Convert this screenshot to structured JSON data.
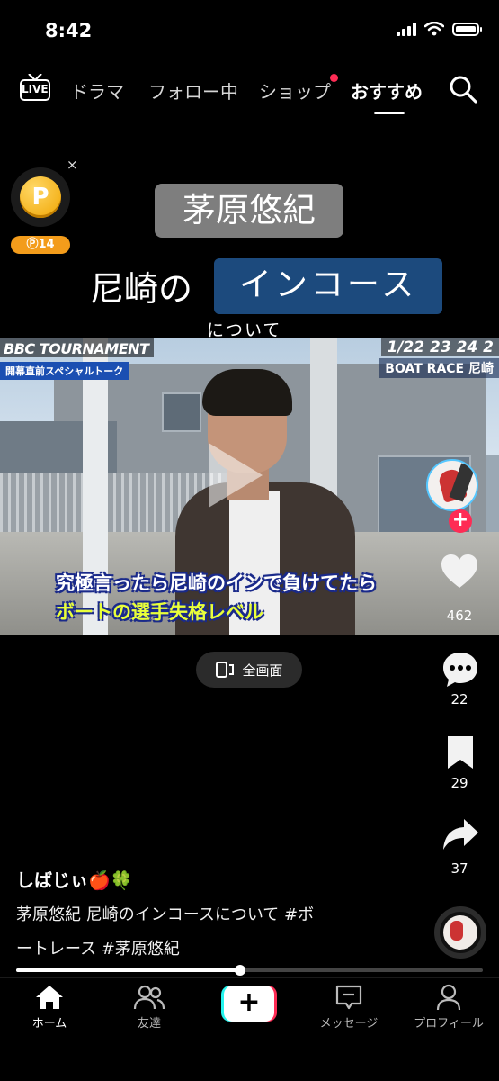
{
  "status_bar": {
    "time": "8:42"
  },
  "top_nav": {
    "live_label": "LIVE",
    "tabs": [
      "ドラマ",
      "フォロー中",
      "ショップ",
      "おすすめ"
    ],
    "active_tab": "おすすめ"
  },
  "coin_widget": {
    "close": "×",
    "symbol": "P",
    "count": "14",
    "count_prefix": "Ⓟ"
  },
  "overlay": {
    "title": "茅原悠紀",
    "line2_prefix": "尼崎の",
    "line2_highlight": "インコース",
    "line3": "について"
  },
  "video": {
    "broadcast_title": "BBC TOURNAMENT",
    "subtitle_badge": "開幕直前スペシャルトーク",
    "dates": "1/22 23 24 2",
    "venue": "BOAT RACE 尼崎",
    "caption_line1": "究極言ったら尼崎のインで負けてたら",
    "caption_line2": "ボートの選手失格レベル"
  },
  "fullscreen": {
    "label": "全画面"
  },
  "actions": {
    "likes": "462",
    "comments": "22",
    "bookmarks": "29",
    "shares": "37"
  },
  "post": {
    "username": "しばじぃ🍎🍀",
    "caption_line1": "茅原悠紀 尼崎のインコースについて #ボ",
    "caption_line2": "ートレース #茅原悠紀"
  },
  "progress": {
    "fraction": 0.48
  },
  "bottom_nav": {
    "home": "ホーム",
    "friends": "友達",
    "create": "+",
    "messages": "メッセージ",
    "profile": "プロフィール"
  },
  "colors": {
    "accent_red": "#fe2c55",
    "accent_cyan": "#25f4ee",
    "coin": "#f39c1b",
    "highlight_blue": "#1c4a7d"
  }
}
